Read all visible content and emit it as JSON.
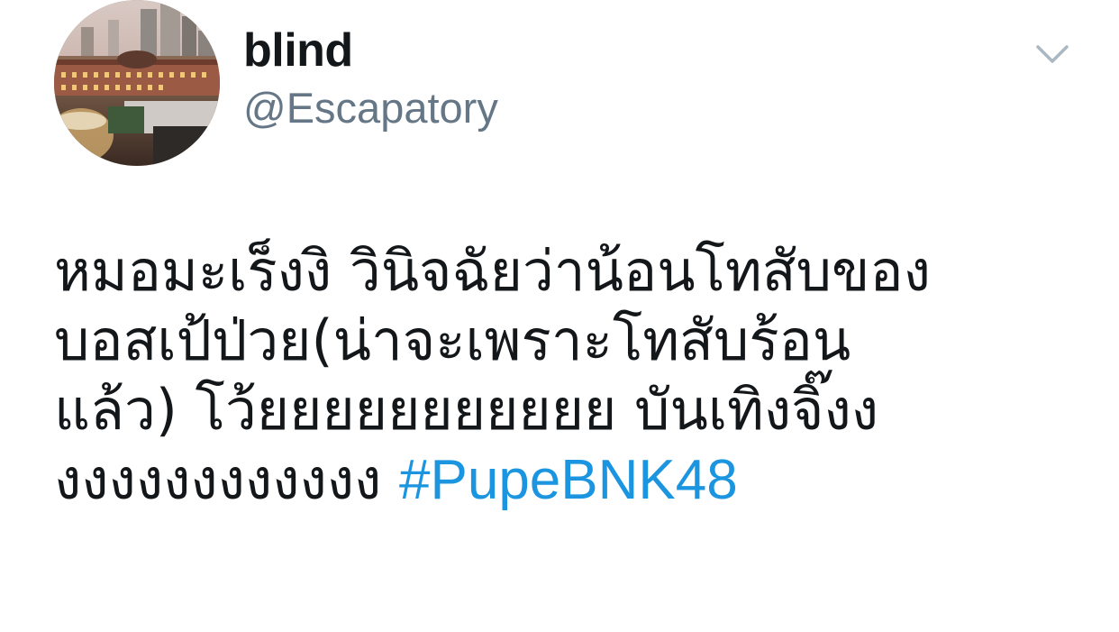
{
  "author": {
    "display_name": "blind",
    "handle": "@Escapatory",
    "avatar_icon": "avatar-photo-station-at-dusk"
  },
  "menu": {
    "icon": "chevron-down-icon",
    "color": "#aab8c2"
  },
  "tweet": {
    "lines": [
      "หมอมะเร็งงิ วินิจฉัยว่าน้อนโทสับของ",
      "บอสเป้ป่วย(น่าจะเพราะโทสับร้อน",
      "แล้ว) โว้ยยยยยยยยยยย บันเทิงจิ๊งง",
      "งงงงงงงงงงงง"
    ],
    "hashtag": "#PupeBNK48"
  },
  "colors": {
    "text": "#14171a",
    "secondary": "#657786",
    "link": "#1b95e0",
    "background": "#ffffff"
  }
}
